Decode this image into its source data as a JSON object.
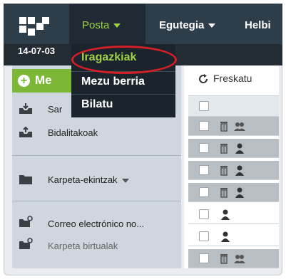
{
  "colors": {
    "accent": "#9fd048",
    "green_button": "#7cb836",
    "topbar": "#2e3d4a",
    "highlight": "#d61e26"
  },
  "nav": {
    "logo_icon": "grid-logo-icon",
    "posta": "Posta",
    "egutegia": "Egutegia",
    "helbi": "Helbi"
  },
  "date": "14-07-03",
  "dropdown": {
    "items": [
      {
        "label": "Iragazkiak",
        "active": true
      },
      {
        "label": "Mezu berria",
        "active": false
      },
      {
        "label": "Bilatu",
        "active": false
      }
    ]
  },
  "sidebar": {
    "new_label": "Me",
    "items": [
      {
        "label": "Sar",
        "icon": "inbox-icon"
      },
      {
        "label": "Bidalitakoak",
        "icon": "sent-icon"
      },
      {
        "label": "Karpeta-ekintzak",
        "icon": "folder-icon"
      },
      {
        "label": "Correo electrónico no...",
        "icon": "folder-gear-icon"
      },
      {
        "label": "Karpeta birtualak",
        "icon": "folder-gear-icon"
      }
    ]
  },
  "toolbar": {
    "refresh_label": "Freskatu"
  },
  "messages": [
    {
      "style": "gray",
      "icon": "group-icon"
    },
    {
      "style": "gray",
      "icon": "person-icon"
    },
    {
      "style": "gray",
      "icon": "person-icon"
    },
    {
      "style": "gray",
      "icon": "person-icon"
    },
    {
      "style": "white",
      "icon": "person-icon"
    },
    {
      "style": "white",
      "icon": "person-icon"
    },
    {
      "style": "gray",
      "icon": "group-icon"
    }
  ]
}
